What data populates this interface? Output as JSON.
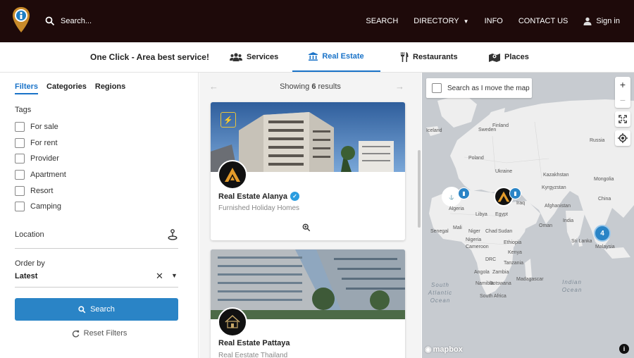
{
  "header": {
    "search_placeholder": "Search...",
    "nav": [
      {
        "label": "SEARCH"
      },
      {
        "label": "DIRECTORY"
      },
      {
        "label": "INFO"
      },
      {
        "label": "CONTACT US"
      }
    ],
    "signin_label": "Sign in",
    "logo_icon": "info-pin-logo-icon"
  },
  "catbar": {
    "tagline": "One Click - Area best service!",
    "tabs": [
      {
        "label": "Services",
        "icon": "users-icon"
      },
      {
        "label": "Real Estate",
        "icon": "bank-icon",
        "active": true
      },
      {
        "label": "Restaurants",
        "icon": "cutlery-icon"
      },
      {
        "label": "Places",
        "icon": "map-icon"
      }
    ]
  },
  "filters": {
    "tabs": [
      {
        "label": "Filters",
        "active": true
      },
      {
        "label": "Categories"
      },
      {
        "label": "Regions"
      }
    ],
    "tags_label": "Tags",
    "tags": [
      "For sale",
      "For rent",
      "Provider",
      "Apartment",
      "Resort",
      "Camping"
    ],
    "location_label": "Location",
    "order_label": "Order by",
    "order_value": "Latest",
    "search_button": "Search",
    "reset_label": "Reset Filters"
  },
  "results": {
    "showing_prefix": "Showing",
    "count": "6",
    "showing_suffix": "results",
    "cards": [
      {
        "title": "Real Estate Alanya",
        "subtitle": "Furnished Holiday Homes",
        "verified": true
      },
      {
        "title": "Real Estate Pattaya",
        "subtitle": "Real Eestate Thailand",
        "verified": false
      }
    ]
  },
  "map": {
    "search_as_move": "Search as I move the map",
    "labels": [
      {
        "text": "Iceland"
      },
      {
        "text": "Sweden"
      },
      {
        "text": "Finland"
      },
      {
        "text": "Russia"
      },
      {
        "text": "Poland"
      },
      {
        "text": "Ukraine"
      },
      {
        "text": "Kazakhstan"
      },
      {
        "text": "Mongolia"
      },
      {
        "text": "Kyrgyzstan"
      },
      {
        "text": "China"
      },
      {
        "text": "Afghanistan"
      },
      {
        "text": "Iraq"
      },
      {
        "text": "Egypt"
      },
      {
        "text": "Algeria"
      },
      {
        "text": "Libya"
      },
      {
        "text": "Mali"
      },
      {
        "text": "Niger"
      },
      {
        "text": "Chad"
      },
      {
        "text": "Sudan"
      },
      {
        "text": "Senegal"
      },
      {
        "text": "Nigeria"
      },
      {
        "text": "Ethiopia"
      },
      {
        "text": "Cameroon"
      },
      {
        "text": "Kenya"
      },
      {
        "text": "DRC"
      },
      {
        "text": "Tanzania"
      },
      {
        "text": "Angola"
      },
      {
        "text": "Zambia"
      },
      {
        "text": "Namibia"
      },
      {
        "text": "Botswana"
      },
      {
        "text": "Madagascar"
      },
      {
        "text": "South Africa"
      },
      {
        "text": "India"
      },
      {
        "text": "Sri Lanka"
      },
      {
        "text": "Malaysia"
      },
      {
        "text": "Oman"
      }
    ],
    "oceans": [
      {
        "text": "South Atlantic Ocean"
      },
      {
        "text": "Indian Ocean"
      }
    ],
    "cluster_count": "4",
    "attribution": "mapbox",
    "accent": "#2a84c6"
  },
  "colors": {
    "topbar": "#1e0a0a",
    "accent": "#1a73c8",
    "button": "#2a84c6"
  }
}
